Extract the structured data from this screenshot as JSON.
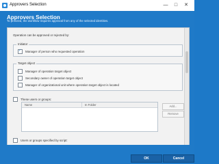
{
  "window": {
    "title": "Approvers Selection"
  },
  "header": {
    "title": "Approvers Selection",
    "subtitle": "To proceed, the workflow requires approval from any of the selected identities."
  },
  "content": {
    "intro": "Operation can be approved or rejected by:",
    "initiator": {
      "title": "Initiator",
      "options": [
        {
          "label": "Manager of person who requested operation",
          "checked": true
        }
      ]
    },
    "target_object": {
      "title": "Target object",
      "options": [
        {
          "label": "Manager of operation target object",
          "checked": false
        },
        {
          "label": "Secondary owner of operation target object",
          "checked": false
        },
        {
          "label": "Manager of organizational unit where operation target object is located",
          "checked": false
        }
      ]
    },
    "users_or_groups": {
      "label": "These users or groups:",
      "checked": false,
      "table_headers": [
        "Name",
        "In Folder"
      ],
      "add_label": "Add...",
      "remove_label": "Remove"
    },
    "script": {
      "label": "Users or groups specified by script:",
      "checked": false
    }
  },
  "footer": {
    "ok": "OK",
    "cancel": "Cancel"
  }
}
